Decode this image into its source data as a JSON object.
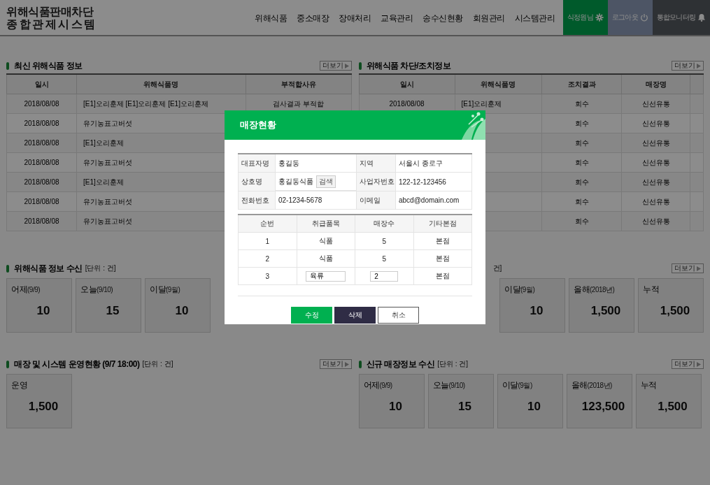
{
  "logo": {
    "line1": "위해식품판매차단",
    "line2": "종합관제시스템"
  },
  "nav": [
    {
      "label": "위해식품",
      "selected": false
    },
    {
      "label": "중소매장",
      "selected": false
    },
    {
      "label": "장애처리",
      "selected": false
    },
    {
      "label": "교육관리",
      "selected": false
    },
    {
      "label": "송수신현황",
      "selected": false
    },
    {
      "label": "회원관리",
      "selected": false
    },
    {
      "label": "시스템관리",
      "selected": false
    }
  ],
  "user_buttons": [
    {
      "kind": "user",
      "label": "식정원님"
    },
    {
      "kind": "logout",
      "label": "로그아웃"
    },
    {
      "kind": "monitor",
      "label": "통합모니터링"
    }
  ],
  "latest_panel": {
    "title": "최신 위해식품 정보",
    "more": "더보기",
    "columns": [
      "일시",
      "위해식품명",
      "부적합사유"
    ],
    "rows": [
      [
        "2018/08/08",
        "[E1]오리훈제 [E1]오리훈제 [E1]오리훈제",
        "검사결과 부적합"
      ],
      [
        "2018/08/08",
        "유기농표고버섯",
        null
      ],
      [
        "2018/08/08",
        "[E1]오리훈제",
        null
      ],
      [
        "2018/08/08",
        "유기농표고버섯",
        null
      ],
      [
        "2018/08/08",
        "[E1]오리훈제",
        null
      ],
      [
        "2018/08/08",
        "유기농표고버섯",
        null
      ],
      [
        "2018/08/08",
        "유기농표고버섯",
        null
      ]
    ]
  },
  "block_panel": {
    "title": "위해식품 차단/조치정보",
    "more": "더보기",
    "columns": [
      "일시",
      "위해식품명",
      "조치결과",
      "매장명"
    ],
    "rows": [
      [
        "2018/08/08",
        "[E1]오리훈제",
        "회수",
        "신선유통"
      ],
      [
        null,
        null,
        "회수",
        "신선유통"
      ],
      [
        null,
        null,
        "회수",
        "신선유통"
      ],
      [
        null,
        null,
        "회수",
        "신선유통"
      ],
      [
        null,
        null,
        "회수",
        "신선유통"
      ],
      [
        null,
        null,
        "회수",
        "신선유통"
      ],
      [
        null,
        null,
        "회수",
        "신선유통"
      ]
    ]
  },
  "receive_panel": {
    "title": "위해식품 정보 수신",
    "unit": "[단위 : 건]",
    "stats": [
      {
        "label": "어제",
        "sub": "(9/9)",
        "value": "10"
      },
      {
        "label": "오늘",
        "sub": "(9/10)",
        "value": "15"
      },
      {
        "label": "이달",
        "sub": "(9월)",
        "value": "10"
      }
    ]
  },
  "receive_panel_2": {
    "unit": "건]",
    "more": "더보기",
    "stats": [
      {
        "label": "이달",
        "sub": "(9월)",
        "value": "10"
      },
      {
        "label": "올해",
        "sub": "(2018년)",
        "value": "1,500"
      },
      {
        "label": "누적",
        "value": "1,500"
      }
    ]
  },
  "operation_panel": {
    "title": "매장 및 시스템 운영현황 (9/7 18:00)",
    "unit": "[단위 : 건]",
    "more": "더보기",
    "stats": [
      {
        "label": "운영",
        "value": "1,500"
      }
    ]
  },
  "new_store_panel": {
    "title": "신규 매장정보 수신",
    "unit": "[단위 : 건]",
    "more": "더보기",
    "stats": [
      {
        "label": "어제",
        "sub": "(9/9)",
        "value": "10"
      },
      {
        "label": "오늘",
        "sub": "(9/10)",
        "value": "15"
      },
      {
        "label": "이달",
        "sub": "(9월)",
        "value": "10"
      },
      {
        "label": "올해",
        "sub": "(2018년)",
        "value": "123,500"
      },
      {
        "label": "누적",
        "value": "1,500"
      }
    ]
  },
  "modal": {
    "title": "매장현황",
    "info": [
      [
        {
          "label": "대표자명",
          "value": "홍길동"
        },
        {
          "label": "지역",
          "value": "서울시 종로구"
        }
      ],
      [
        {
          "label": "상호명",
          "value": "홍길동식품",
          "button": "검색"
        },
        {
          "label": "사업자번호",
          "value": "122-12-123456"
        }
      ],
      [
        {
          "label": "전화번호",
          "value": "02-1234-5678"
        },
        {
          "label": "이메일",
          "value": "abcd@domain.com"
        }
      ]
    ],
    "columns": [
      "순번",
      "취급품목",
      "매장수",
      "기타본점"
    ],
    "rows": [
      {
        "kind": "text",
        "cells": [
          "1",
          "식품",
          "5",
          "본점"
        ]
      },
      {
        "kind": "text",
        "cells": [
          "2",
          "식품",
          "5",
          "본점"
        ]
      },
      {
        "kind": "edit",
        "cells": [
          "3",
          "육류",
          "2",
          "본점"
        ]
      }
    ],
    "buttons": [
      {
        "kind": "primary",
        "label": "수정"
      },
      {
        "kind": "dark",
        "label": "삭제"
      },
      {
        "kind": "plain",
        "label": "취소"
      }
    ]
  }
}
